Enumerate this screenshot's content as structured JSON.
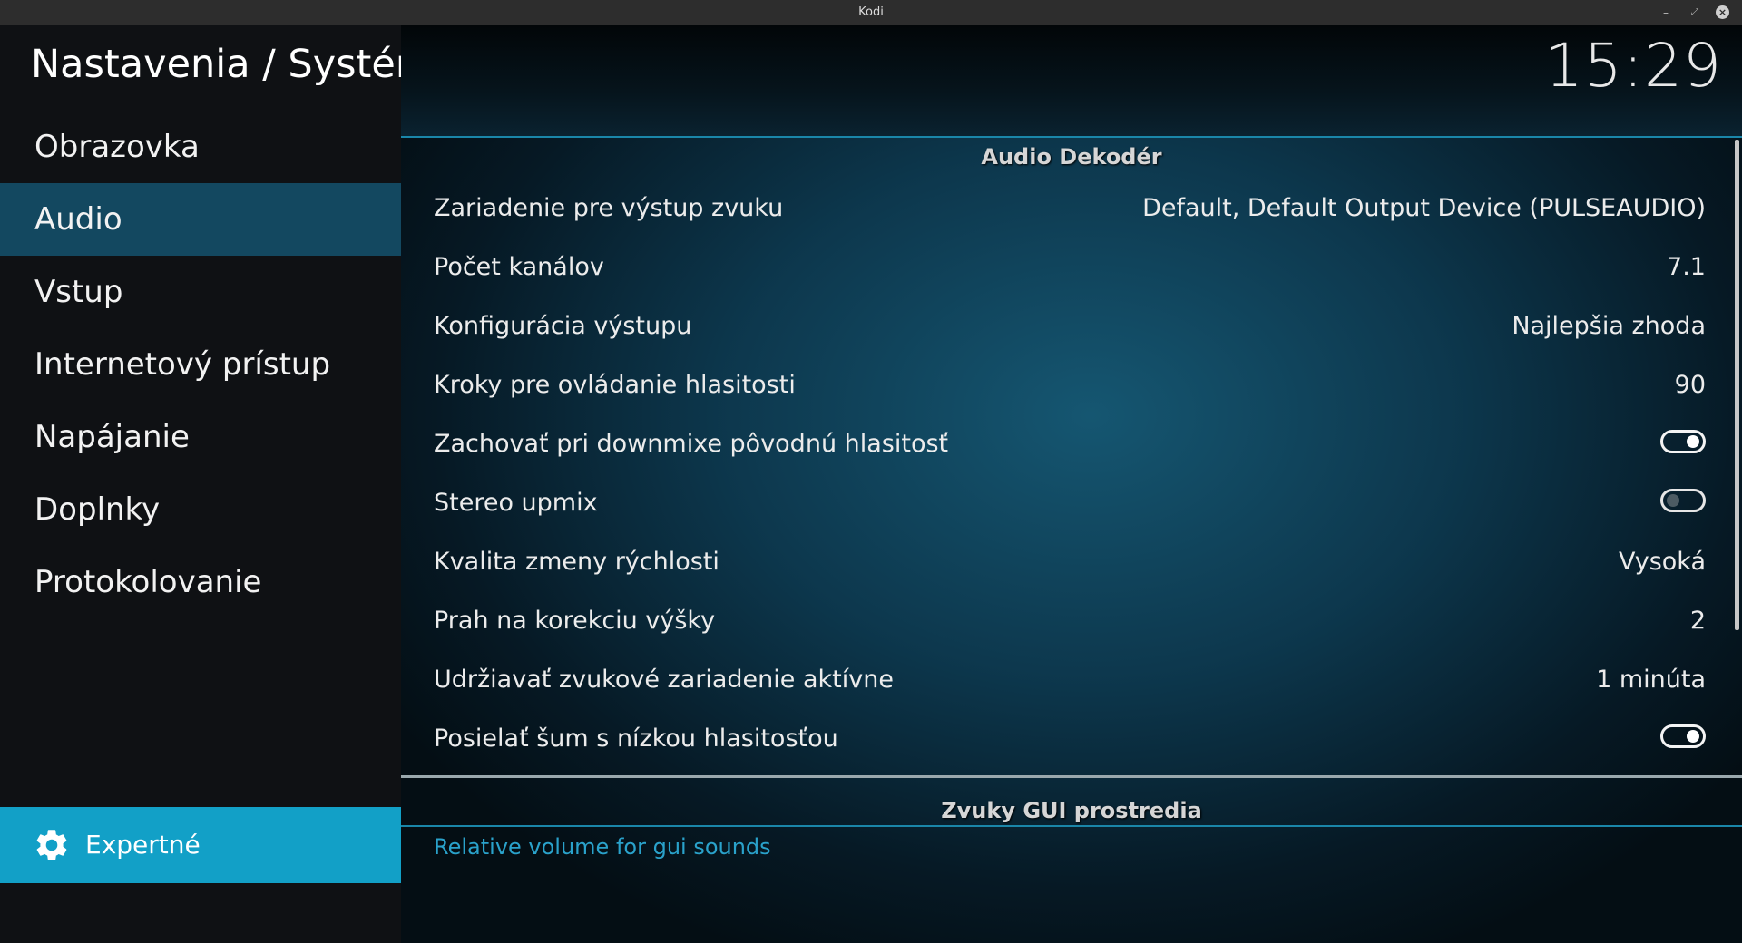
{
  "window": {
    "title": "Kodi",
    "controls": {
      "minimize": "–",
      "maximize": "⤢",
      "close": "×"
    }
  },
  "sidebar": {
    "title": "Nastavenia / Systém",
    "items": [
      {
        "label": "Obrazovka",
        "selected": false
      },
      {
        "label": "Audio",
        "selected": true
      },
      {
        "label": "Vstup",
        "selected": false
      },
      {
        "label": "Internetový prístup",
        "selected": false
      },
      {
        "label": "Napájanie",
        "selected": false
      },
      {
        "label": "Doplnky",
        "selected": false
      },
      {
        "label": "Protokolovanie",
        "selected": false
      }
    ],
    "level_button": {
      "label": "Expertné",
      "icon": "gear-icon"
    }
  },
  "header": {
    "clock": "15:29"
  },
  "sections": [
    {
      "title": "Audio Dekodér",
      "rows": [
        {
          "label": "Zariadenie pre výstup zvuku",
          "value": "Default, Default Output Device (PULSEAUDIO)"
        },
        {
          "label": "Počet kanálov",
          "value": "7.1"
        },
        {
          "label": "Konfigurácia výstupu",
          "value": "Najlepšia zhoda"
        },
        {
          "label": "Kroky pre ovládanie hlasitosti",
          "value": "90"
        },
        {
          "label": "Zachovať pri downmixe pôvodnú hlasitosť",
          "toggle": true
        },
        {
          "label": "Stereo upmix",
          "toggle": false
        },
        {
          "label": "Kvalita zmeny rýchlosti",
          "value": "Vysoká"
        },
        {
          "label": "Prah na korekciu výšky",
          "value": "2"
        },
        {
          "label": "Udržiavať zvukové zariadenie aktívne",
          "value": "1 minúta"
        },
        {
          "label": "Posielať šum s nízkou hlasitosťou",
          "toggle": true
        }
      ]
    },
    {
      "title": "Zvuky GUI prostredia",
      "rows": [
        {
          "label": "Relative volume for gui sounds"
        }
      ]
    }
  ],
  "colors": {
    "sidebar_bg": "#0f1114",
    "selected_bg": "#134860",
    "expert_bg": "#12a0c7",
    "accent": "#1a86a9",
    "link_text": "#2aa2cb"
  }
}
